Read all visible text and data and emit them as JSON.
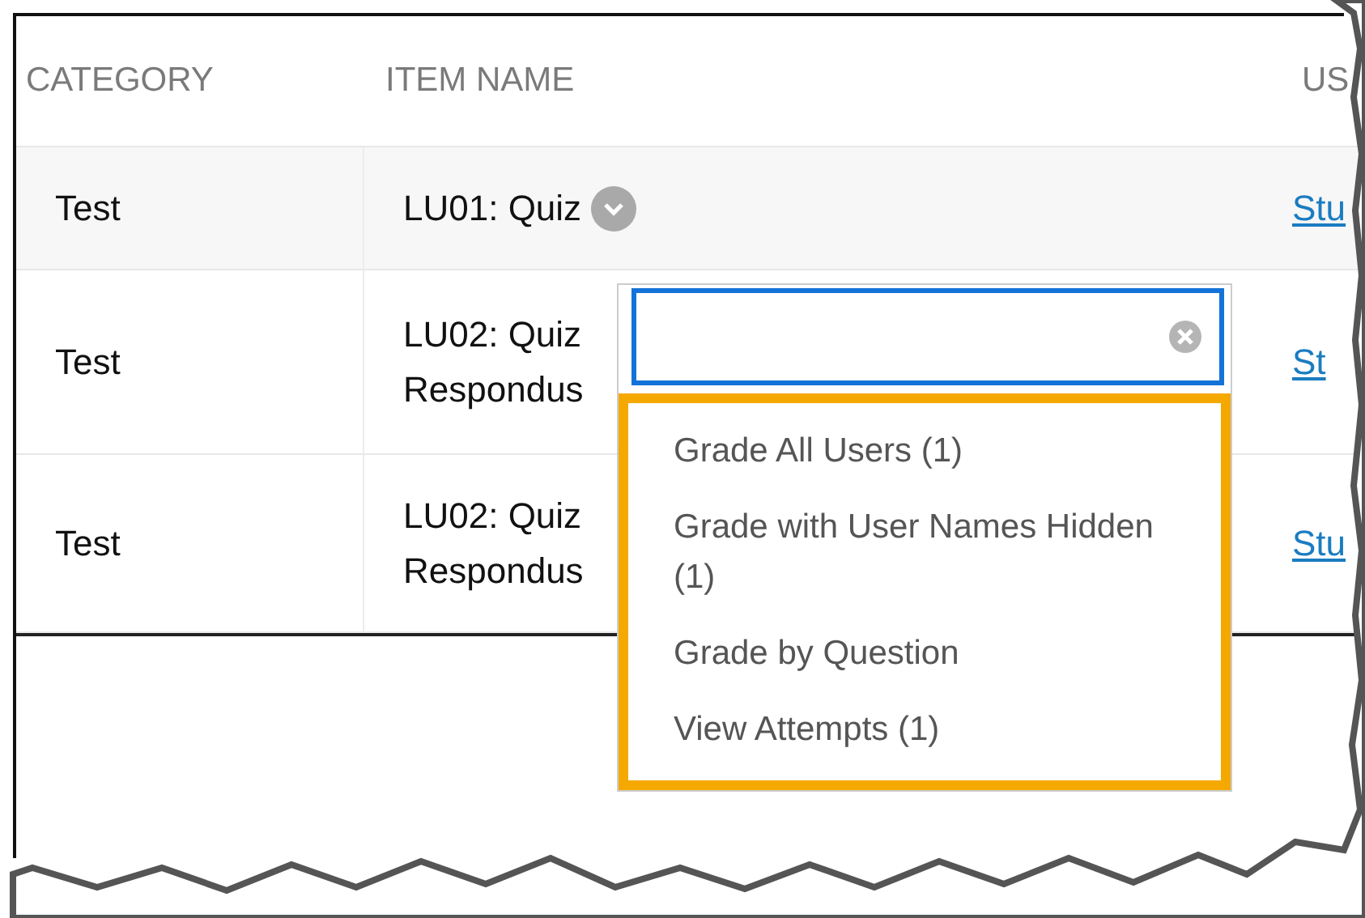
{
  "table": {
    "columns": [
      "CATEGORY",
      "ITEM NAME",
      "US"
    ],
    "rows": [
      {
        "category": "Test",
        "item_name": "LU01: Quiz",
        "menu_button": true,
        "user": "Stu"
      },
      {
        "category": "Test",
        "item_name": "LU02: Quiz Respondus",
        "user": "St"
      },
      {
        "category": "Test",
        "item_name": "LU02: Quiz Respondus",
        "user": "Stu"
      }
    ]
  },
  "dropdown": {
    "items": [
      "Grade All Users (1)",
      "Grade with User Names Hidden (1)",
      "Grade by Question",
      "View Attempts (1)"
    ]
  }
}
